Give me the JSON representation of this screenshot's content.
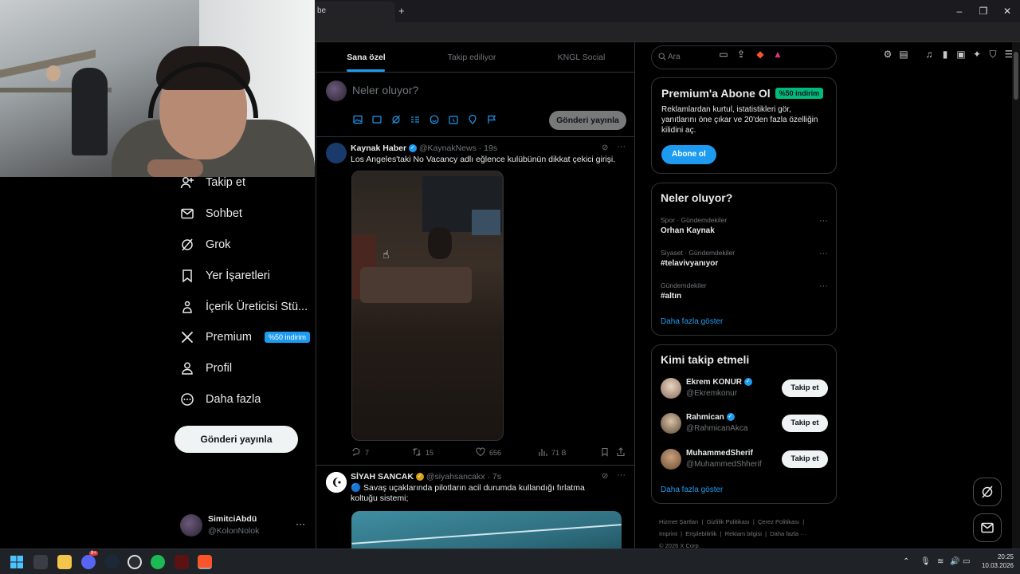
{
  "browser": {
    "tab_title": "be",
    "new_tab": "+",
    "window": {
      "minimize": "–",
      "restore": "❐",
      "close": "✕"
    }
  },
  "nav": {
    "items": [
      {
        "label": "Takip et",
        "icon": "add-user-icon"
      },
      {
        "label": "Sohbet",
        "icon": "mail-icon"
      },
      {
        "label": "Grok",
        "icon": "grok-icon"
      },
      {
        "label": "Yer İşaretleri",
        "icon": "bookmark-icon"
      },
      {
        "label": "İçerik Üreticisi Stü...",
        "icon": "creator-studio-icon"
      },
      {
        "label": "Premium",
        "icon": "x-logo-icon",
        "badge": "%50 indirim"
      },
      {
        "label": "Profil",
        "icon": "profile-icon"
      },
      {
        "label": "Daha fazla",
        "icon": "more-circle-icon"
      }
    ],
    "post_button": "Gönderi yayınla",
    "account": {
      "name": "SimitciAbdü",
      "handle": "@KolonNolok",
      "more": "···"
    }
  },
  "timeline": {
    "tabs": [
      "Sana özel",
      "Takip ediliyor",
      "KNGL Social"
    ],
    "composer": {
      "placeholder": "Neler oluyor?",
      "post_button": "Gönderi yayınla"
    },
    "posts": [
      {
        "author": "Kaynak Haber",
        "handle": "@KaynakNews",
        "time": "· 19s",
        "text": "Los Angeles'taki No Vacancy adlı eğlence kulübünün dikkat çekici girişi.",
        "replies": "7",
        "reposts": "15",
        "likes": "656",
        "views": "71 B"
      },
      {
        "author": "SİYAH SANCAK",
        "handle": "@siyahsancakx",
        "time": "· 7s",
        "text": "🔵 Savaş uçaklarında pilotların acil durumda kullandığı fırlatma koltuğu sistemi;"
      }
    ]
  },
  "right": {
    "search_placeholder": "Ara",
    "premium": {
      "title": "Premium'a Abone Ol",
      "badge": "%50 indirim",
      "text": "Reklamlardan kurtul, istatistikleri gör, yanıtlarını öne çıkar ve 20'den fazla özelliğin kilidini aç.",
      "button": "Abone ol"
    },
    "trends": {
      "title": "Neler oluyor?",
      "items": [
        {
          "category": "Spor · Gündemdekiler",
          "name": "Orhan Kaynak"
        },
        {
          "category": "Siyaset · Gündemdekiler",
          "name": "#telavivyanıyor"
        },
        {
          "category": "Gündemdekiler",
          "name": "#altın"
        }
      ],
      "more": "Daha fazla göster"
    },
    "who_to_follow": {
      "title": "Kimi takip etmeli",
      "users": [
        {
          "name": "Ekrem KONUR",
          "handle": "@Ekremkonur",
          "button": "Takip et"
        },
        {
          "name": "Rahmican",
          "handle": "@RahmicanAkca",
          "button": "Takip et"
        },
        {
          "name": "MuhammedSherif",
          "handle": "@MuhammedShherif",
          "button": "Takip et"
        }
      ],
      "more": "Daha fazla göster"
    },
    "footer": {
      "links": [
        "Hizmet Şartları",
        "Gizlilik Politikası",
        "Çerez Politikası",
        "Imprint",
        "Erişilebilirlik",
        "Reklam bilgisi",
        "Daha fazla ···"
      ],
      "copyright": "© 2026 X Corp."
    }
  },
  "taskbar": {
    "time": "20:25",
    "date": "10.03.2026",
    "discord_badge": "9+"
  },
  "colors": {
    "accent": "#1d9bf0",
    "background": "#000000",
    "border": "#2f3336",
    "muted": "#71767b"
  }
}
